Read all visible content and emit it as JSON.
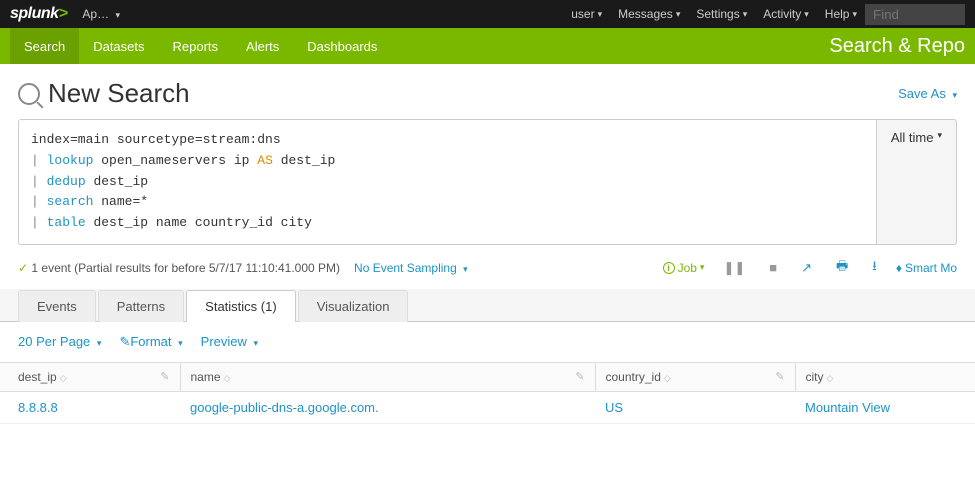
{
  "topbar": {
    "logo": "splunk",
    "app_label": "Ap…",
    "menus": [
      "user",
      "Messages",
      "Settings",
      "Activity",
      "Help"
    ],
    "find_placeholder": "Find"
  },
  "greenbar": {
    "items": [
      "Search",
      "Datasets",
      "Reports",
      "Alerts",
      "Dashboards"
    ],
    "active_index": 0,
    "app_title": "Search & Repo"
  },
  "page": {
    "title": "New Search",
    "save_as": "Save As"
  },
  "search_query": {
    "line1_plain": "index=main sourcetype=stream:dns",
    "line2_cmd": "lookup",
    "line2_rest_a": "open_nameservers ip",
    "line2_kw": "AS",
    "line2_rest_b": "dest_ip",
    "line3_cmd": "dedup",
    "line3_rest": "dest_ip",
    "line4_cmd": "search",
    "line4_rest": "name=*",
    "line5_cmd": "table",
    "line5_rest": "dest_ip name country_id city"
  },
  "time_picker": {
    "label": "All time"
  },
  "status": {
    "text": "1 event (Partial results for before 5/7/17 11:10:41.000 PM)",
    "sampling": "No Event Sampling",
    "job": "Job",
    "smart": "Smart Mo"
  },
  "tabs": {
    "items": [
      "Events",
      "Patterns",
      "Statistics (1)",
      "Visualization"
    ],
    "active_index": 2
  },
  "table_controls": {
    "per_page": "20 Per Page",
    "format": "Format",
    "preview": "Preview"
  },
  "table": {
    "columns": [
      "dest_ip",
      "name",
      "country_id",
      "city"
    ],
    "rows": [
      {
        "dest_ip": "8.8.8.8",
        "name": "google-public-dns-a.google.com.",
        "country_id": "US",
        "city": "Mountain View"
      }
    ]
  }
}
